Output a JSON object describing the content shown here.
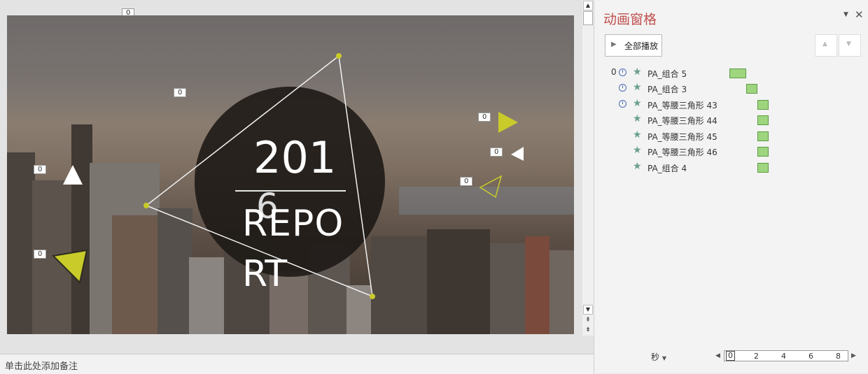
{
  "slide": {
    "year": "201",
    "year_digit": "6",
    "title_line1": "REPO",
    "title_line2": "RT",
    "marker_tags": [
      "0",
      "0",
      "0",
      "0",
      "0",
      "0",
      "0"
    ]
  },
  "notes": {
    "placeholder": "单击此处添加备注"
  },
  "animation_pane": {
    "title": "动画窗格",
    "play_all_label": "全部播放",
    "items": [
      {
        "order": "0",
        "clock": true,
        "name": "PA_组合 5"
      },
      {
        "order": "",
        "clock": true,
        "name": "PA_组合 3"
      },
      {
        "order": "",
        "clock": true,
        "name": "PA_等腰三角形 43"
      },
      {
        "order": "",
        "clock": false,
        "name": "PA_等腰三角形 44"
      },
      {
        "order": "",
        "clock": false,
        "name": "PA_等腰三角形 45"
      },
      {
        "order": "",
        "clock": false,
        "name": "PA_等腰三角形 46"
      },
      {
        "order": "",
        "clock": false,
        "name": "PA_组合 4"
      }
    ],
    "time_unit_label": "秒",
    "timeline_ticks": [
      "0",
      "2",
      "4",
      "6",
      "8"
    ],
    "colors": {
      "title": "#c0504d",
      "bar_fill": "#9ed57e",
      "star": "#6a9f8c"
    }
  }
}
